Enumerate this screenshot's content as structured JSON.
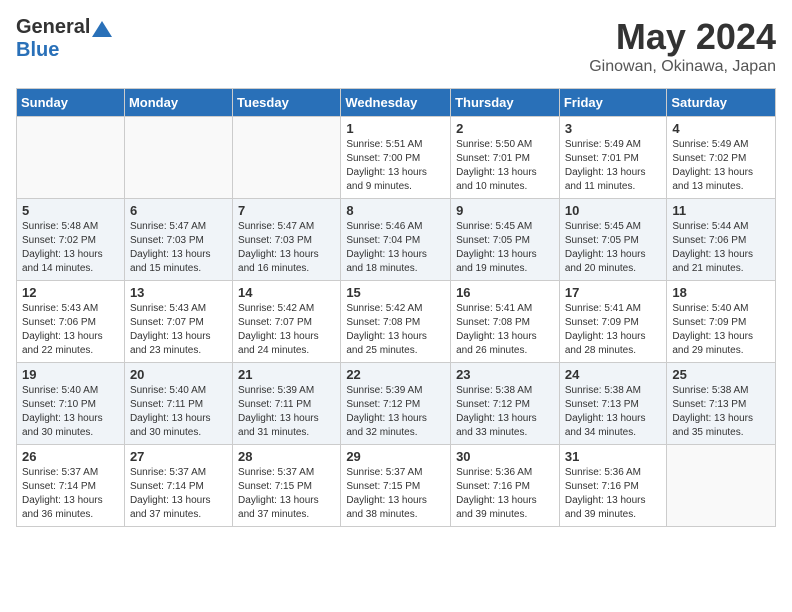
{
  "header": {
    "logo_general": "General",
    "logo_blue": "Blue",
    "month_year": "May 2024",
    "location": "Ginowan, Okinawa, Japan"
  },
  "weekdays": [
    "Sunday",
    "Monday",
    "Tuesday",
    "Wednesday",
    "Thursday",
    "Friday",
    "Saturday"
  ],
  "weeks": [
    [
      {
        "day": "",
        "info": ""
      },
      {
        "day": "",
        "info": ""
      },
      {
        "day": "",
        "info": ""
      },
      {
        "day": "1",
        "info": "Sunrise: 5:51 AM\nSunset: 7:00 PM\nDaylight: 13 hours\nand 9 minutes."
      },
      {
        "day": "2",
        "info": "Sunrise: 5:50 AM\nSunset: 7:01 PM\nDaylight: 13 hours\nand 10 minutes."
      },
      {
        "day": "3",
        "info": "Sunrise: 5:49 AM\nSunset: 7:01 PM\nDaylight: 13 hours\nand 11 minutes."
      },
      {
        "day": "4",
        "info": "Sunrise: 5:49 AM\nSunset: 7:02 PM\nDaylight: 13 hours\nand 13 minutes."
      }
    ],
    [
      {
        "day": "5",
        "info": "Sunrise: 5:48 AM\nSunset: 7:02 PM\nDaylight: 13 hours\nand 14 minutes."
      },
      {
        "day": "6",
        "info": "Sunrise: 5:47 AM\nSunset: 7:03 PM\nDaylight: 13 hours\nand 15 minutes."
      },
      {
        "day": "7",
        "info": "Sunrise: 5:47 AM\nSunset: 7:03 PM\nDaylight: 13 hours\nand 16 minutes."
      },
      {
        "day": "8",
        "info": "Sunrise: 5:46 AM\nSunset: 7:04 PM\nDaylight: 13 hours\nand 18 minutes."
      },
      {
        "day": "9",
        "info": "Sunrise: 5:45 AM\nSunset: 7:05 PM\nDaylight: 13 hours\nand 19 minutes."
      },
      {
        "day": "10",
        "info": "Sunrise: 5:45 AM\nSunset: 7:05 PM\nDaylight: 13 hours\nand 20 minutes."
      },
      {
        "day": "11",
        "info": "Sunrise: 5:44 AM\nSunset: 7:06 PM\nDaylight: 13 hours\nand 21 minutes."
      }
    ],
    [
      {
        "day": "12",
        "info": "Sunrise: 5:43 AM\nSunset: 7:06 PM\nDaylight: 13 hours\nand 22 minutes."
      },
      {
        "day": "13",
        "info": "Sunrise: 5:43 AM\nSunset: 7:07 PM\nDaylight: 13 hours\nand 23 minutes."
      },
      {
        "day": "14",
        "info": "Sunrise: 5:42 AM\nSunset: 7:07 PM\nDaylight: 13 hours\nand 24 minutes."
      },
      {
        "day": "15",
        "info": "Sunrise: 5:42 AM\nSunset: 7:08 PM\nDaylight: 13 hours\nand 25 minutes."
      },
      {
        "day": "16",
        "info": "Sunrise: 5:41 AM\nSunset: 7:08 PM\nDaylight: 13 hours\nand 26 minutes."
      },
      {
        "day": "17",
        "info": "Sunrise: 5:41 AM\nSunset: 7:09 PM\nDaylight: 13 hours\nand 28 minutes."
      },
      {
        "day": "18",
        "info": "Sunrise: 5:40 AM\nSunset: 7:09 PM\nDaylight: 13 hours\nand 29 minutes."
      }
    ],
    [
      {
        "day": "19",
        "info": "Sunrise: 5:40 AM\nSunset: 7:10 PM\nDaylight: 13 hours\nand 30 minutes."
      },
      {
        "day": "20",
        "info": "Sunrise: 5:40 AM\nSunset: 7:11 PM\nDaylight: 13 hours\nand 30 minutes."
      },
      {
        "day": "21",
        "info": "Sunrise: 5:39 AM\nSunset: 7:11 PM\nDaylight: 13 hours\nand 31 minutes."
      },
      {
        "day": "22",
        "info": "Sunrise: 5:39 AM\nSunset: 7:12 PM\nDaylight: 13 hours\nand 32 minutes."
      },
      {
        "day": "23",
        "info": "Sunrise: 5:38 AM\nSunset: 7:12 PM\nDaylight: 13 hours\nand 33 minutes."
      },
      {
        "day": "24",
        "info": "Sunrise: 5:38 AM\nSunset: 7:13 PM\nDaylight: 13 hours\nand 34 minutes."
      },
      {
        "day": "25",
        "info": "Sunrise: 5:38 AM\nSunset: 7:13 PM\nDaylight: 13 hours\nand 35 minutes."
      }
    ],
    [
      {
        "day": "26",
        "info": "Sunrise: 5:37 AM\nSunset: 7:14 PM\nDaylight: 13 hours\nand 36 minutes."
      },
      {
        "day": "27",
        "info": "Sunrise: 5:37 AM\nSunset: 7:14 PM\nDaylight: 13 hours\nand 37 minutes."
      },
      {
        "day": "28",
        "info": "Sunrise: 5:37 AM\nSunset: 7:15 PM\nDaylight: 13 hours\nand 37 minutes."
      },
      {
        "day": "29",
        "info": "Sunrise: 5:37 AM\nSunset: 7:15 PM\nDaylight: 13 hours\nand 38 minutes."
      },
      {
        "day": "30",
        "info": "Sunrise: 5:36 AM\nSunset: 7:16 PM\nDaylight: 13 hours\nand 39 minutes."
      },
      {
        "day": "31",
        "info": "Sunrise: 5:36 AM\nSunset: 7:16 PM\nDaylight: 13 hours\nand 39 minutes."
      },
      {
        "day": "",
        "info": ""
      }
    ]
  ]
}
